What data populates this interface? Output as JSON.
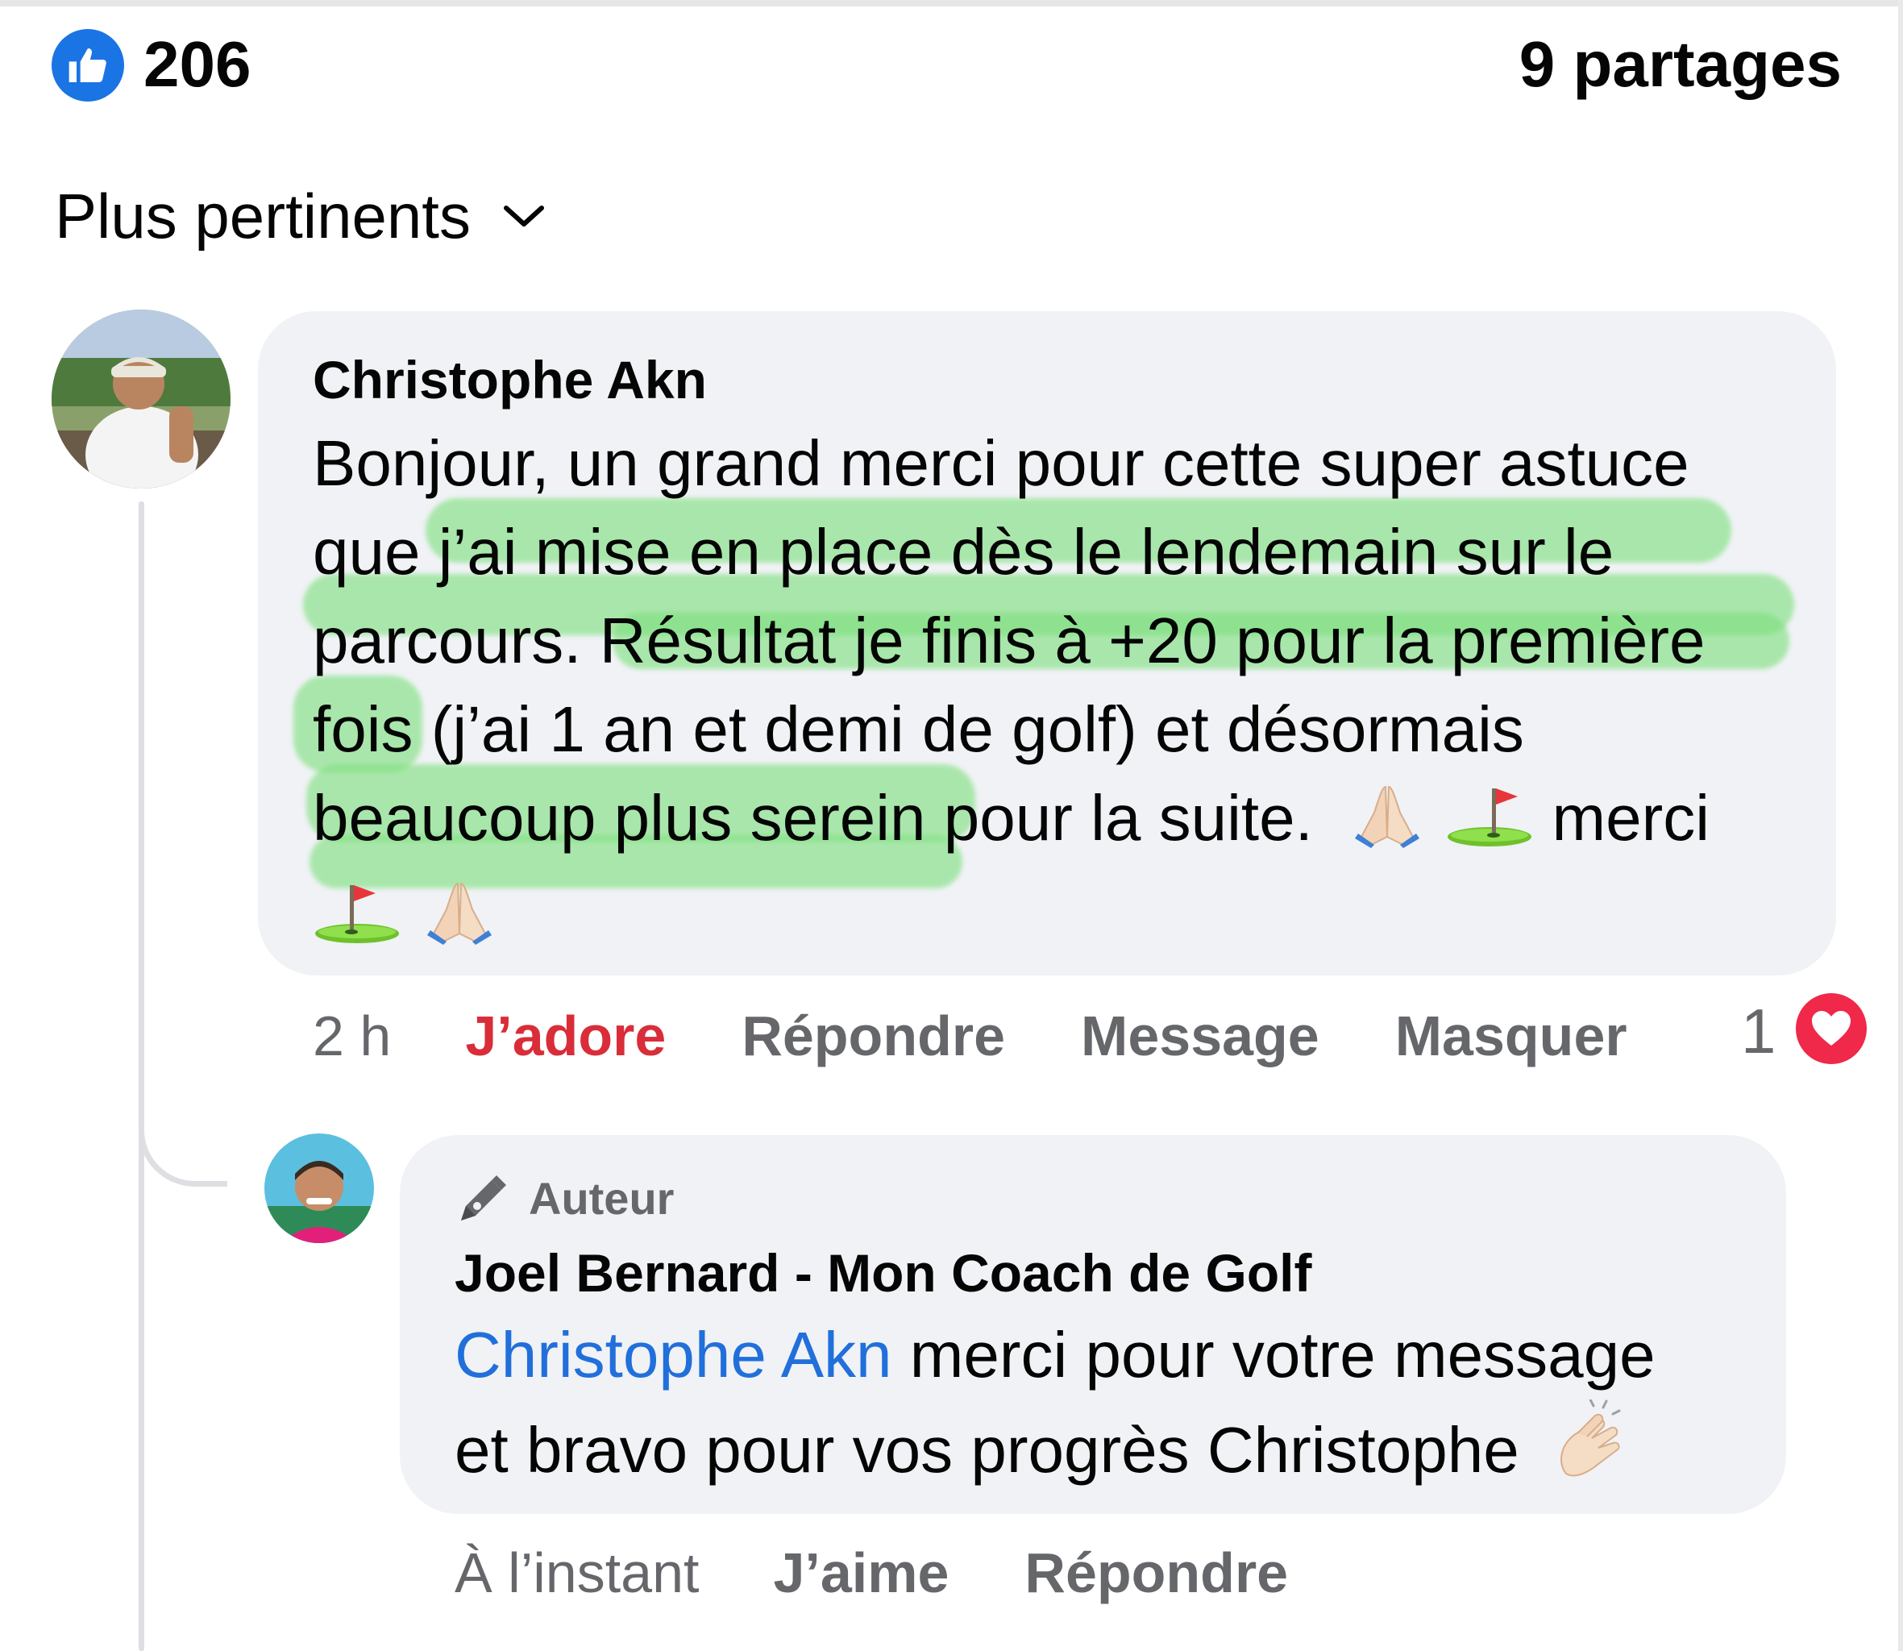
{
  "reactions": {
    "like_icon": "thumbs-up-icon",
    "like_count": "206",
    "shares": "9 partages",
    "like_color": "#1b74e4"
  },
  "sort": {
    "label": "Plus pertinents",
    "icon": "chevron-down-icon"
  },
  "comment": {
    "author": "Christophe Akn",
    "lines": [
      "Bonjour, un grand merci pour cette super astuce",
      "que j’ai mise en place dès le lendemain sur le",
      "parcours. Résultat je finis à +20 pour la première",
      "fois (j’ai 1 an et demi de golf) et désormais",
      "beaucoup plus serein pour la suite.",
      "merci"
    ],
    "emojis": [
      "praying-hands-icon",
      "golf-flag-icon",
      "golf-flag-icon",
      "praying-hands-icon"
    ],
    "highlight_color": "#7ee07e",
    "time": "2 h",
    "love_label": "J’adore",
    "reply_label": "Répondre",
    "message_label": "Message",
    "hide_label": "Masquer",
    "love_count": "1",
    "love_color": "#f02849"
  },
  "reply": {
    "badge_icon": "pen-icon",
    "badge_label": "Auteur",
    "author": "Joel Bernard - Mon Coach de Golf",
    "mention": "Christophe Akn",
    "text_line1": " merci pour votre message",
    "text_line2": "et bravo pour vos progrès Christophe",
    "emoji": "clapping-hands-icon",
    "mention_color": "#216fdb",
    "time": "À l’instant",
    "like_label": "J’aime",
    "reply_label": "Répondre"
  }
}
